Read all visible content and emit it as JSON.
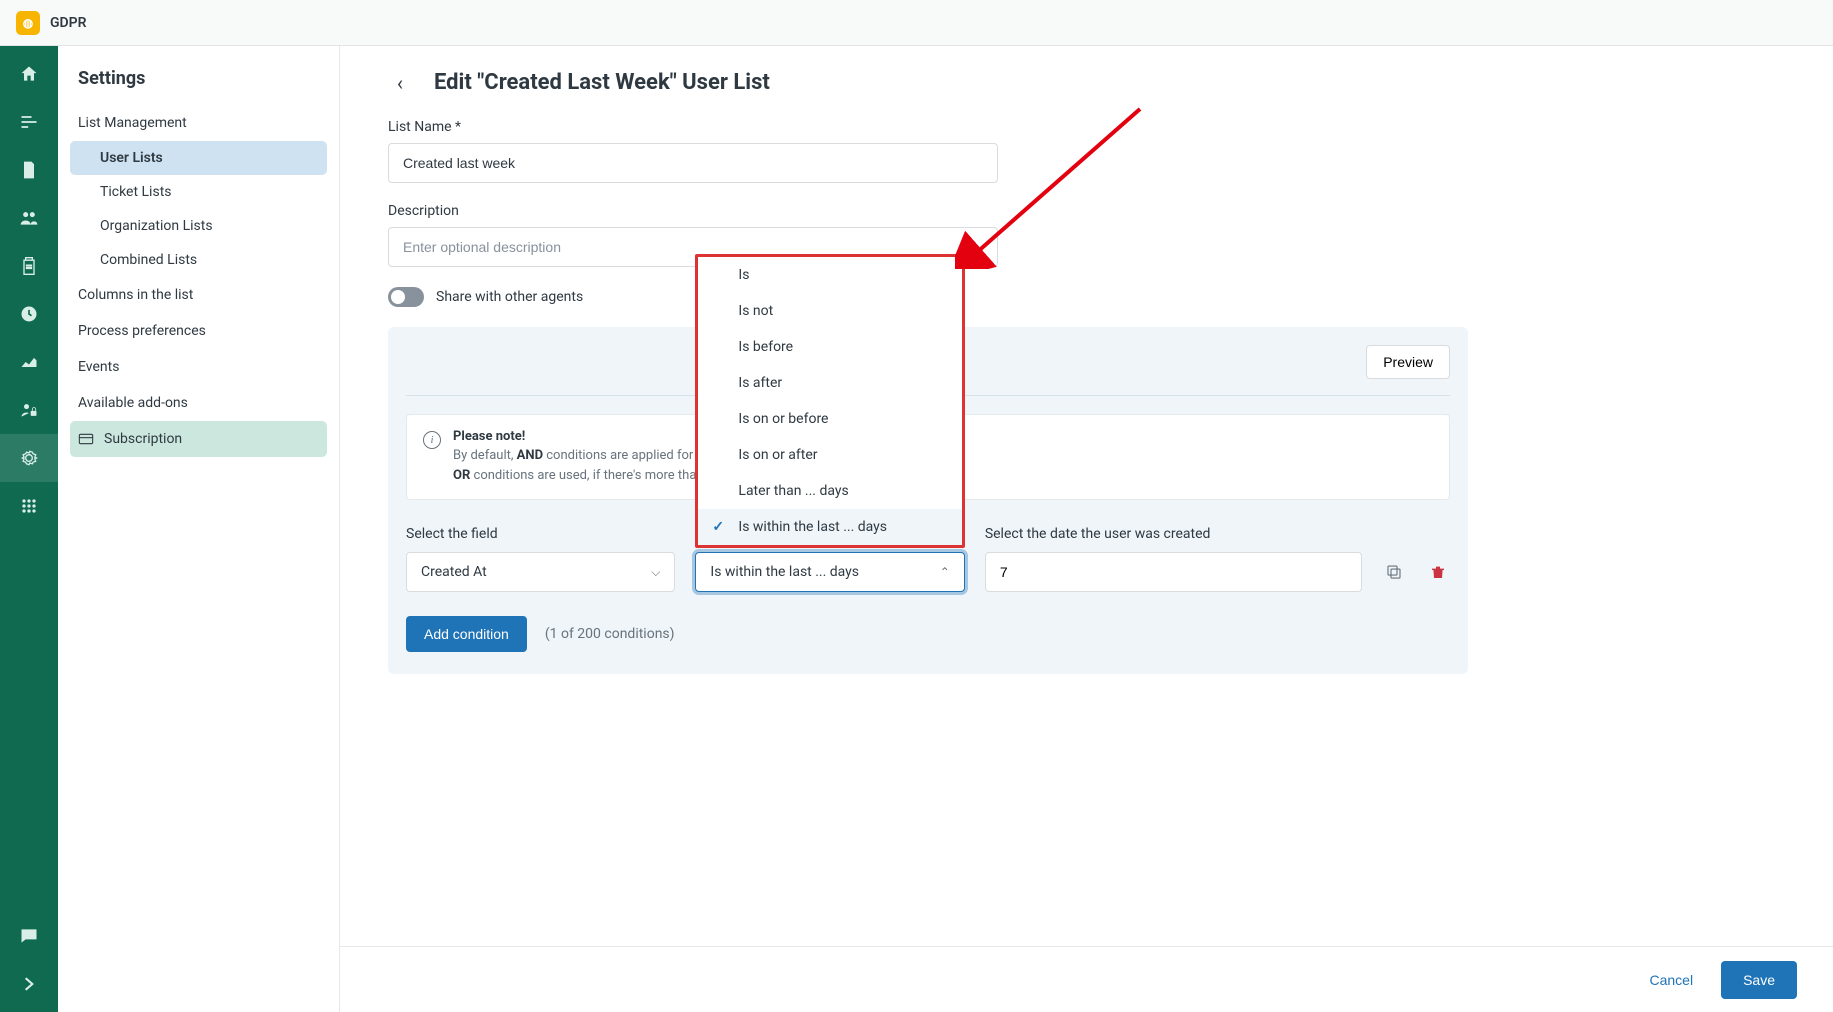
{
  "app": {
    "name": "GDPR"
  },
  "sidebar": {
    "title": "Settings",
    "group_list_mgmt": "List Management",
    "items": {
      "user_lists": "User Lists",
      "ticket_lists": "Ticket Lists",
      "org_lists": "Organization Lists",
      "combined_lists": "Combined Lists"
    },
    "columns": "Columns in the list",
    "process_prefs": "Process preferences",
    "events": "Events",
    "addons": "Available add-ons",
    "subscription": "Subscription"
  },
  "page": {
    "title": "Edit \"Created Last Week\" User List",
    "fields": {
      "list_name_label": "List Name *",
      "list_name_value": "Created last week",
      "description_label": "Description",
      "description_placeholder": "Enter optional description",
      "share_label": "Share with other agents"
    },
    "preview_btn": "Preview",
    "note": {
      "title": "Please note!",
      "line1_pre": "By default, ",
      "line1_bold": "AND",
      "line1_post": " conditions are applied for acti",
      "line2_bold": "OR",
      "line2_post": " conditions are used, if there's more than on"
    },
    "condition": {
      "field_label": "Select the field",
      "field_value": "Created At",
      "operator_value": "Is within the last ... days",
      "value_label": "Select the date the user was created",
      "value_value": "7"
    },
    "dropdown_options": [
      "Is",
      "Is not",
      "Is before",
      "Is after",
      "Is on or before",
      "Is on or after",
      "Later than ... days",
      "Is within the last ... days"
    ],
    "add_btn": "Add condition",
    "count_text": "(1 of 200 conditions)"
  },
  "footer": {
    "cancel": "Cancel",
    "save": "Save"
  }
}
